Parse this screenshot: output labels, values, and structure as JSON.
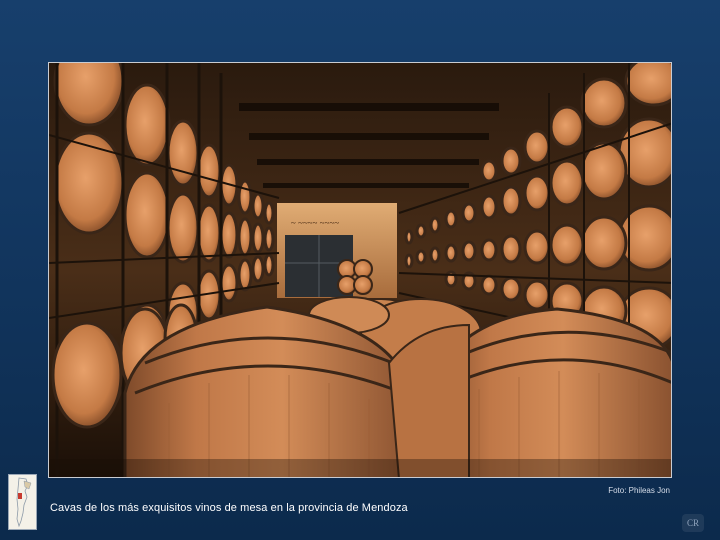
{
  "photo": {
    "subject": "wine-barrel-cellar",
    "accent_colors": {
      "wood": "#c9804c",
      "hoop": "#3a2618",
      "wall": "#d7a06a"
    }
  },
  "credit": "Foto: Phileas Jon",
  "caption": "Cavas de los más exquisitos vinos de mesa en la provincia de Mendoza",
  "logo_text": "CR",
  "map_icon": "argentina-map-icon"
}
